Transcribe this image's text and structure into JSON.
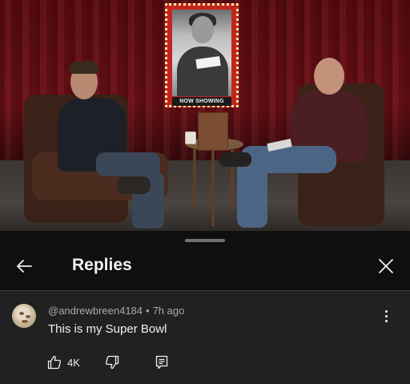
{
  "video": {
    "poster_caption": "NOW SHOWING"
  },
  "sheet": {
    "title": "Replies",
    "back_icon": "arrow-left-icon",
    "close_icon": "close-icon"
  },
  "comment": {
    "author": "@andrewbreen4184",
    "separator": "•",
    "time": "7h ago",
    "text": "This is my Super Bowl",
    "likes": "4K",
    "icons": {
      "like": "thumbs-up-icon",
      "dislike": "thumbs-down-icon",
      "reply": "reply-comment-icon",
      "menu": "more-vert-icon"
    }
  },
  "colors": {
    "background": "#0f0f0f",
    "panel": "#212121",
    "text_primary": "#f1f1f1",
    "text_secondary": "#aaaaaa"
  }
}
